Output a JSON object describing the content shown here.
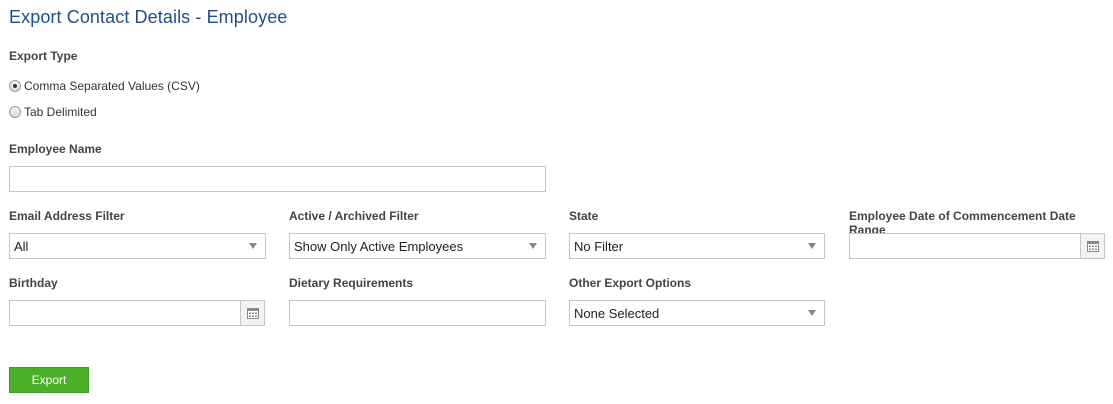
{
  "page": {
    "title": "Export Contact Details - Employee"
  },
  "export_type": {
    "label": "Export Type",
    "options": [
      {
        "label": "Comma Separated Values (CSV)",
        "checked": true
      },
      {
        "label": "Tab Delimited",
        "checked": false
      }
    ]
  },
  "employee_name": {
    "label": "Employee Name",
    "value": ""
  },
  "email_filter": {
    "label": "Email Address Filter",
    "selected": "All"
  },
  "active_filter": {
    "label": "Active / Archived Filter",
    "selected": "Show Only Active Employees"
  },
  "state": {
    "label": "State",
    "selected": "No Filter"
  },
  "commencement": {
    "label": "Employee Date of Commencement Date Range",
    "value": ""
  },
  "birthday": {
    "label": "Birthday",
    "value": ""
  },
  "dietary": {
    "label": "Dietary Requirements",
    "value": ""
  },
  "other_options": {
    "label": "Other Export Options",
    "selected": "None Selected"
  },
  "actions": {
    "export_label": "Export"
  },
  "icons": {
    "calendar": "calendar-icon",
    "dropdown": "chevron-down-icon",
    "radio": "radio-icon"
  },
  "colors": {
    "title": "#1e4e8c",
    "export_button": "#4caf2a",
    "border": "#c6c6c6"
  }
}
